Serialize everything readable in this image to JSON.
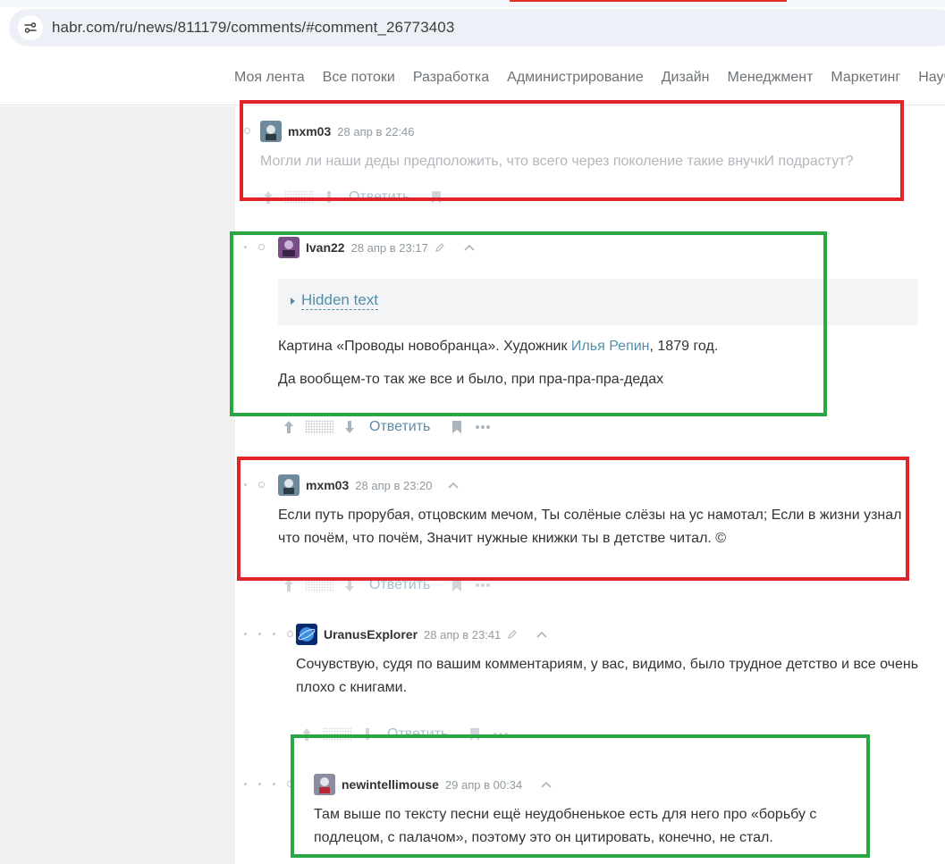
{
  "browser": {
    "url": "habr.com/ru/news/811179/comments/#comment_26773403"
  },
  "nav": {
    "items": [
      "Моя лента",
      "Все потоки",
      "Разработка",
      "Администрирование",
      "Дизайн",
      "Менеджмент",
      "Маркетинг",
      "Научпоп"
    ]
  },
  "comments": [
    {
      "username": "mxm03",
      "time": "28 апр в 22:46",
      "text": "Могли ли наши деды предположить, что всего через поколение такие внучкИ подрастут?",
      "reply_label": "Ответить"
    },
    {
      "username": "Ivan22",
      "time": "28 апр в 23:17",
      "spoiler_title": "Hidden text",
      "text_line1_a": "Картина «Проводы новобранца». Художник ",
      "text_line1_link": "Илья Репин",
      "text_line1_b": ", 1879 год.",
      "text_line2": "Да вообщем-то так же все и было, при пра-пра-пра-дедах",
      "reply_label": "Ответить"
    },
    {
      "username": "mxm03",
      "time": "28 апр в 23:20",
      "text": "Если путь прорубая, отцовским мечом, Ты солёные слёзы на ус намотал; Если в жизни узнал что почём, что почём, Значит нужные книжки ты в детстве читал. ©",
      "reply_label": "Ответить"
    },
    {
      "username": "UranusExplorer",
      "time": "28 апр в 23:41",
      "text": "Сочувствую, судя по вашим комментариям, у вас, видимо, было трудное детство и все очень плохо с книгами.",
      "reply_label": "Ответить"
    },
    {
      "username": "newintellimouse",
      "time": "29 апр в 00:34",
      "text": "Там выше по тексту песни ещё неудобненькое есть для него про «борьбу с подлецом, с палачом», поэтому это он цитировать, конечно, не стал."
    }
  ],
  "colors": {
    "highlight_red": "#e0252a",
    "highlight_green": "#2aa744",
    "link": "#548eaa"
  }
}
